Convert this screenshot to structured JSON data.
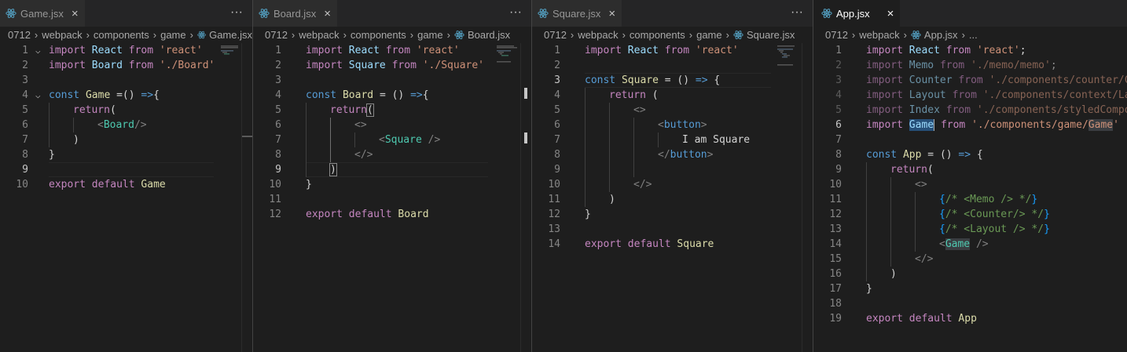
{
  "panes": [
    {
      "id": "game",
      "tab": {
        "label": "Game.jsx",
        "close": "×",
        "active": false
      },
      "more": "···",
      "breadcrumb": [
        "0712",
        "webpack",
        "components",
        "game",
        "Game.jsx"
      ],
      "line_numbers": [
        "1",
        "2",
        "3",
        "4",
        "5",
        "6",
        "7",
        "8",
        "9",
        "10"
      ],
      "current_line": 9
    },
    {
      "id": "board",
      "tab": {
        "label": "Board.jsx",
        "close": "×",
        "active": false
      },
      "more": "···",
      "breadcrumb": [
        "0712",
        "webpack",
        "components",
        "game",
        "Board.jsx"
      ],
      "line_numbers": [
        "1",
        "2",
        "3",
        "4",
        "5",
        "6",
        "7",
        "8",
        "9",
        "10",
        "11",
        "12"
      ],
      "current_line": 9
    },
    {
      "id": "square",
      "tab": {
        "label": "Square.jsx",
        "close": "×",
        "active": false
      },
      "more": "···",
      "breadcrumb": [
        "0712",
        "webpack",
        "components",
        "game",
        "Square.jsx"
      ],
      "line_numbers": [
        "1",
        "2",
        "3",
        "4",
        "5",
        "6",
        "7",
        "8",
        "9",
        "10",
        "11",
        "12",
        "13",
        "14"
      ],
      "current_line": 3
    },
    {
      "id": "app",
      "tab": {
        "label": "App.jsx",
        "close": "×",
        "active": true
      },
      "breadcrumb": [
        "0712",
        "webpack",
        "App.jsx",
        "..."
      ],
      "line_numbers": [
        "1",
        "2",
        "3",
        "4",
        "5",
        "6",
        "7",
        "8",
        "9",
        "10",
        "11",
        "12",
        "13",
        "14",
        "15",
        "16",
        "17",
        "18",
        "19"
      ],
      "current_line": 6
    }
  ],
  "code": {
    "game": {
      "l1": {
        "a": "import",
        "b": "React",
        "c": "from",
        "d": "'react'"
      },
      "l2": {
        "a": "import",
        "b": "Board",
        "c": "from",
        "d": "'./Board'"
      },
      "l4": {
        "a": "const",
        "b": "Game",
        "c": "=()",
        "d": "=>",
        "e": "{"
      },
      "l5": {
        "a": "return",
        "b": "("
      },
      "l6": {
        "a": "<",
        "b": "Board",
        "c": "/>"
      },
      "l7": {
        "a": ")"
      },
      "l8": {
        "a": "}"
      },
      "l10": {
        "a": "export",
        "b": "default",
        "c": "Game"
      }
    },
    "board": {
      "l1": {
        "a": "import",
        "b": "React",
        "c": "from",
        "d": "'react'"
      },
      "l2": {
        "a": "import",
        "b": "Square",
        "c": "from",
        "d": "'./Square'"
      },
      "l4": {
        "a": "const",
        "b": "Board",
        "c": "=",
        "d": "()",
        "e": "=>",
        "f": "{"
      },
      "l5": {
        "a": "return",
        "b": "("
      },
      "l6": {
        "a": "<>"
      },
      "l7": {
        "a": "<",
        "b": "Square",
        "c": "/>"
      },
      "l8": {
        "a": "</>"
      },
      "l9": {
        "a": ")"
      },
      "l10": {
        "a": "}"
      },
      "l12": {
        "a": "export",
        "b": "default",
        "c": "Board"
      }
    },
    "square": {
      "l1": {
        "a": "import",
        "b": "React",
        "c": "from",
        "d": "'react'"
      },
      "l3": {
        "a": "const",
        "b": "Square",
        "c": "=",
        "d": "()",
        "e": "=>",
        "f": "{"
      },
      "l4": {
        "a": "return",
        "b": "("
      },
      "l5": {
        "a": "<>"
      },
      "l6": {
        "a": "<",
        "b": "button",
        "c": ">"
      },
      "l7": {
        "a": "I am Square"
      },
      "l8": {
        "a": "</",
        "b": "button",
        "c": ">"
      },
      "l10": {
        "a": "</>"
      },
      "l11": {
        "a": ")"
      },
      "l12": {
        "a": "}"
      },
      "l14": {
        "a": "export",
        "b": "default",
        "c": "Square"
      }
    },
    "app": {
      "l1": {
        "a": "import",
        "b": "React",
        "c": "from",
        "d": "'react'",
        "e": ";"
      },
      "l2": {
        "a": "import",
        "b": "Memo",
        "c": "from",
        "d": "'./memo/memo'",
        "e": ";"
      },
      "l3": {
        "a": "import",
        "b": "Counter",
        "c": "from",
        "d": "'./components/counter/C"
      },
      "l4": {
        "a": "import",
        "b": "Layout",
        "c": "from",
        "d": "'./components/context/La"
      },
      "l5": {
        "a": "import",
        "b": "Index",
        "c": "from",
        "d": "'./components/styledCompo"
      },
      "l6": {
        "a": "import",
        "b": "Game",
        "c": "from",
        "d": "'./components/game/",
        "e": "Game",
        "f": "'"
      },
      "l8": {
        "a": "const",
        "b": "App",
        "c": "=",
        "d": "()",
        "e": "=>",
        "f": "{"
      },
      "l9": {
        "a": "return",
        "b": "("
      },
      "l10": {
        "a": "<>"
      },
      "l11": {
        "a": "{",
        "b": "/* <Memo /> */",
        "c": "}"
      },
      "l12": {
        "a": "{",
        "b": "/* <Counter/> */",
        "c": "}"
      },
      "l13": {
        "a": "{",
        "b": "/* <Layout /> */",
        "c": "}"
      },
      "l14": {
        "a": "<",
        "b": "Game",
        "c": "/>"
      },
      "l15": {
        "a": "</>"
      },
      "l16": {
        "a": ")"
      },
      "l17": {
        "a": "}"
      },
      "l19": {
        "a": "export",
        "b": "default",
        "c": "App"
      }
    }
  },
  "colors": {
    "background": "#1e1e1e",
    "tabbar": "#252526",
    "inactive_tab": "#2d2d2d",
    "keyword": "#c586c0",
    "declaration": "#569cd6",
    "variable": "#9cdcfe",
    "function": "#dcdcaa",
    "string": "#ce9178",
    "component": "#4ec9b0",
    "comment": "#6a9955",
    "react_icon": "#519aba"
  },
  "icons": {
    "file": "react-icon",
    "close": "close-icon",
    "more": "more-actions-icon",
    "fold": "chevron-down-icon",
    "separator": "chevron-right-icon"
  }
}
